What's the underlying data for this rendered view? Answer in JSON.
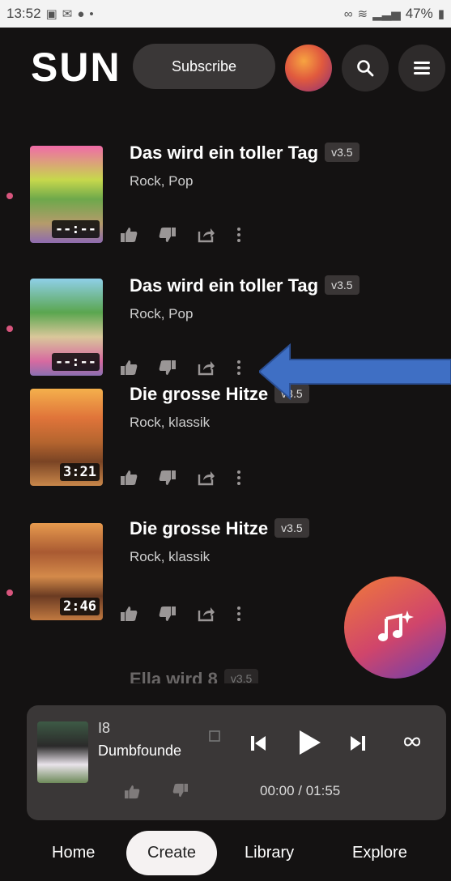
{
  "status_bar": {
    "time": "13:52",
    "battery": "47%"
  },
  "header": {
    "logo": "SUN",
    "subscribe_label": "Subscribe"
  },
  "songs": [
    {
      "title": "Das wird ein toller Tag",
      "version": "v3.5",
      "genre": "Rock, Pop",
      "duration": "--:--"
    },
    {
      "title": "Das wird ein toller Tag",
      "version": "v3.5",
      "genre": "Rock, Pop",
      "duration": "--:--"
    },
    {
      "title": "Die grosse Hitze",
      "version": "v3.5",
      "genre": "Rock, klassik",
      "duration": "3:21"
    },
    {
      "title": "Die grosse Hitze",
      "version": "v3.5",
      "genre": "Rock, klassik",
      "duration": "2:46"
    },
    {
      "title": "Ella wird 8",
      "version": "v3.5"
    }
  ],
  "player": {
    "track_line": "I8",
    "subtitle": "Dumbfounde",
    "time": "00:00 / 01:55"
  },
  "nav": {
    "home": "Home",
    "create": "Create",
    "library": "Library",
    "explore": "Explore"
  },
  "colors": {
    "background": "#141212",
    "accent_dot": "#d8557d",
    "arrow": "#3f6fc4",
    "fab_gradient": [
      "#f07a3a",
      "#d0456b",
      "#6a3fb0"
    ]
  }
}
